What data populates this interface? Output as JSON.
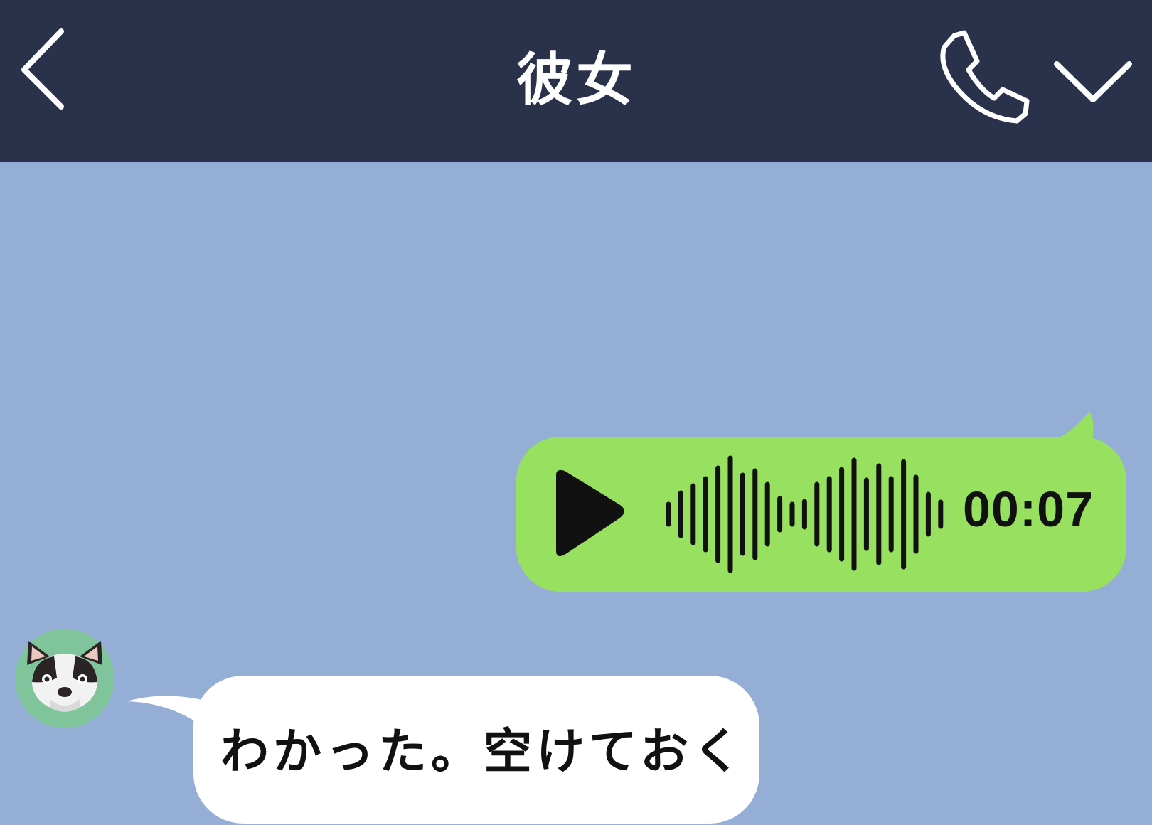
{
  "header": {
    "title": "彼女",
    "back_icon": "chevron-left-icon",
    "call_icon": "phone-icon",
    "menu_icon": "chevron-down-icon",
    "background": "#29324a"
  },
  "chat": {
    "background": "#95aed6",
    "messages": [
      {
        "sender": "self",
        "type": "voice",
        "duration": "00:07",
        "bubble_color": "#98e05f",
        "icon": "play-icon"
      },
      {
        "sender": "other",
        "type": "text",
        "text": "わかった。空けておく",
        "bubble_color": "#ffffff",
        "avatar": "french-bulldog-avatar"
      }
    ]
  }
}
